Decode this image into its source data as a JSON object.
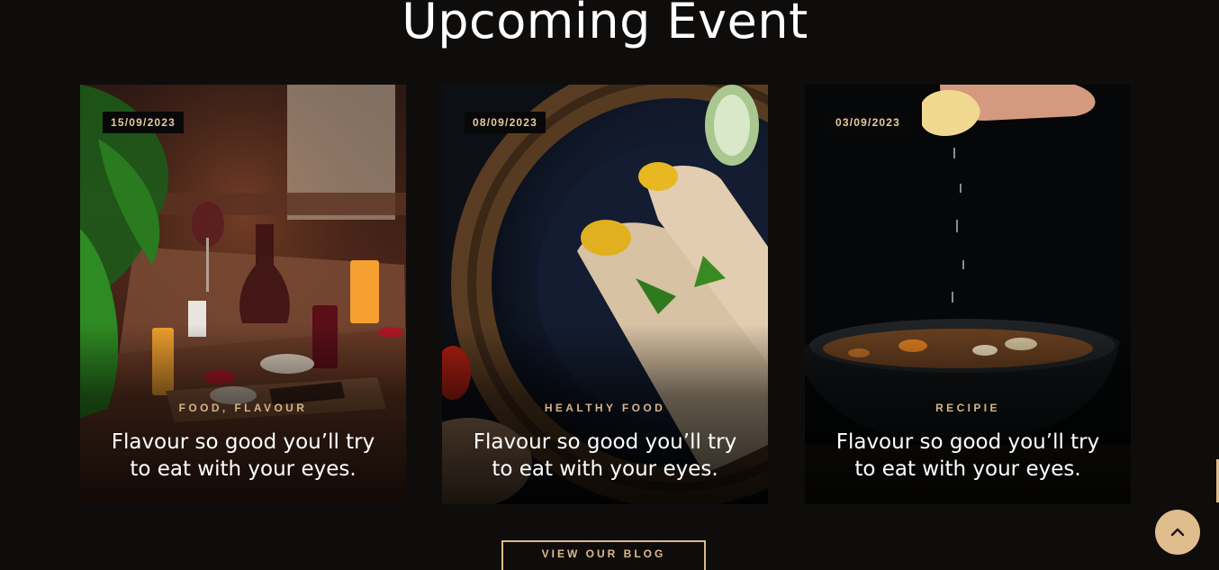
{
  "section": {
    "title": "Upcoming Event"
  },
  "events": [
    {
      "date": "15/09/2023",
      "category": "FOOD, FLAVOUR",
      "title": "Flavour so good you’ll try to eat with your eyes.",
      "image": "restaurant-table-photo"
    },
    {
      "date": "08/09/2023",
      "category": "HEALTHY FOOD",
      "title": "Flavour so good you’ll try to eat with your eyes.",
      "image": "dosa-plate-photo"
    },
    {
      "date": "03/09/2023",
      "category": "RECIPIE",
      "title": "Flavour so good you’ll try to eat with your eyes.",
      "image": "soup-bowl-photo"
    }
  ],
  "cta": {
    "label": "VIEW OUR BLOG"
  },
  "scroll_top": {
    "icon": "chevron-up-icon"
  },
  "colors": {
    "background": "#0f0d0c",
    "accent": "#e0bd8d",
    "category_text": "#d5b48a",
    "date_text": "#e8c9a0"
  }
}
